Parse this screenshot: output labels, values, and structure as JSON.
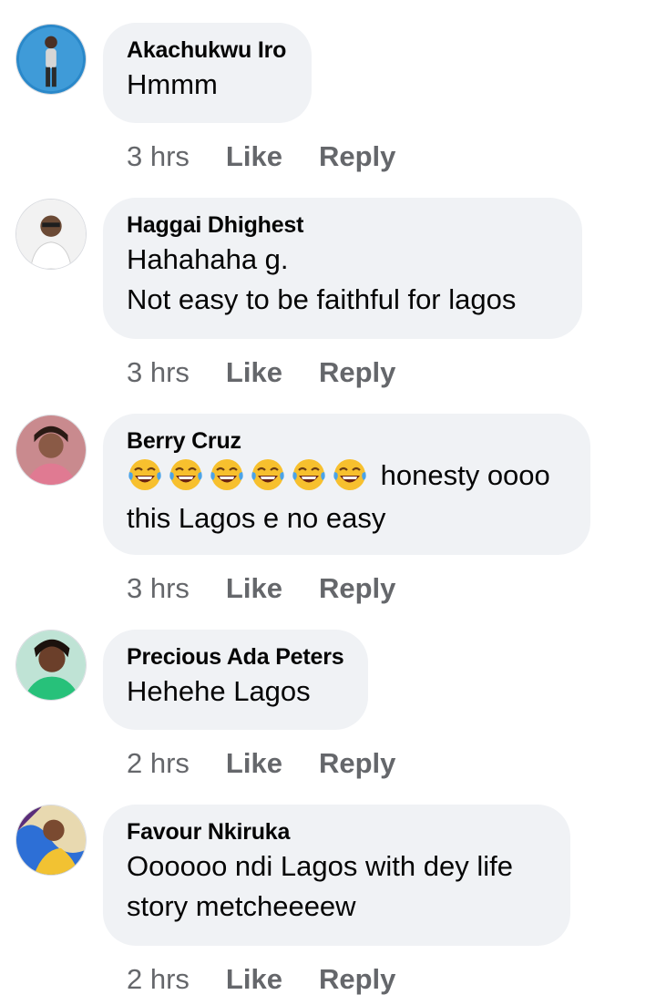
{
  "comments": [
    {
      "author": "Akachukwu Iro",
      "lines": [
        "Hmmm"
      ],
      "time": "3 hrs",
      "like": "Like",
      "reply": "Reply"
    },
    {
      "author": "Haggai Dhighest",
      "lines": [
        "Hahahaha g.",
        "Not easy to be faithful for lagos"
      ],
      "time": "3 hrs",
      "like": "Like",
      "reply": "Reply"
    },
    {
      "author": "Berry Cruz",
      "emoji_icons": [
        "tears-of-joy-emoji",
        "tears-of-joy-emoji",
        "tears-of-joy-emoji",
        "tears-of-joy-emoji",
        "tears-of-joy-emoji",
        "tears-of-joy-emoji"
      ],
      "lines": [
        "honesty oooo",
        "this Lagos e no easy"
      ],
      "time": "3 hrs",
      "like": "Like",
      "reply": "Reply"
    },
    {
      "author": "Precious Ada Peters",
      "lines": [
        "Hehehe Lagos"
      ],
      "time": "2 hrs",
      "like": "Like",
      "reply": "Reply"
    },
    {
      "author": "Favour Nkiruka",
      "lines": [
        "Oooooo ndi Lagos with dey life",
        "story metcheeeew"
      ],
      "time": "2 hrs",
      "like": "Like",
      "reply": "Reply"
    }
  ],
  "colors": {
    "bubble": "#f0f2f5",
    "text": "#050505",
    "meta": "#65676b"
  }
}
